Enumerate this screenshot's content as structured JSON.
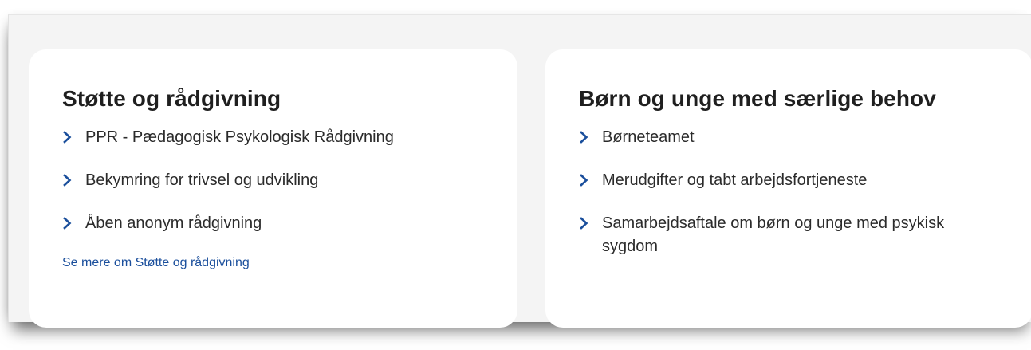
{
  "colors": {
    "accent": "#1b4f9c",
    "card_bg": "#ffffff",
    "page_bg": "#f4f4f4",
    "text": "#2b2b2b"
  },
  "cards": [
    {
      "title": "Støtte og rådgivning",
      "items": [
        {
          "label": "PPR - Pædagogisk Psykologisk Rådgivning",
          "icon": "chevron-right-icon"
        },
        {
          "label": "Bekymring for trivsel og udvikling",
          "icon": "chevron-right-icon"
        },
        {
          "label": "Åben anonym rådgivning",
          "icon": "chevron-right-icon"
        }
      ],
      "see_more": "Se mere om Støtte og rådgivning"
    },
    {
      "title": "Børn og unge med særlige behov",
      "items": [
        {
          "label": "Børneteamet",
          "icon": "chevron-right-icon"
        },
        {
          "label": "Merudgifter og tabt arbejdsfortjeneste",
          "icon": "chevron-right-icon"
        },
        {
          "label": "Samarbejdsaftale om børn og unge med psykisk sygdom",
          "icon": "chevron-right-icon"
        }
      ]
    }
  ]
}
